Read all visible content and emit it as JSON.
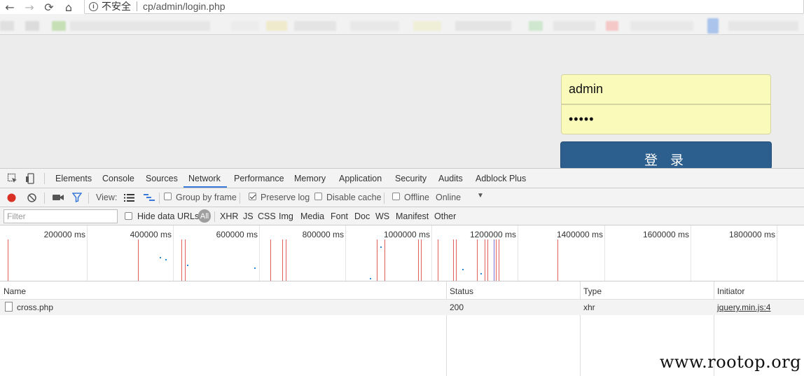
{
  "browser": {
    "insecure_label": "不安全",
    "url": "cp/admin/login.php"
  },
  "login": {
    "username_value": "admin",
    "password_value": "•••••",
    "submit_label": "登 录"
  },
  "devtools": {
    "tabs": [
      "Elements",
      "Console",
      "Sources",
      "Network",
      "Performance",
      "Memory",
      "Application",
      "Security",
      "Audits",
      "Adblock Plus"
    ],
    "active_tab": "Network",
    "toolbar": {
      "view_label": "View:",
      "group_by_frame": "Group by frame",
      "preserve_log": "Preserve log",
      "disable_cache": "Disable cache",
      "offline": "Offline",
      "throttle": "Online"
    },
    "filter": {
      "placeholder": "Filter",
      "hide_data_urls": "Hide data URLs",
      "types": [
        "All",
        "XHR",
        "JS",
        "CSS",
        "Img",
        "Media",
        "Font",
        "Doc",
        "WS",
        "Manifest",
        "Other"
      ]
    },
    "overview_ticks": [
      "200000 ms",
      "400000 ms",
      "600000 ms",
      "800000 ms",
      "1000000 ms",
      "1200000 ms",
      "1400000 ms",
      "1600000 ms",
      "1800000 ms"
    ],
    "columns": [
      "Name",
      "Status",
      "Type",
      "Initiator"
    ],
    "rows": [
      {
        "name": "cross.php",
        "status": "200",
        "type": "xhr",
        "initiator": "jquery.min.js:4"
      }
    ]
  },
  "watermark": "www.rootop.org",
  "colors": {
    "record": "#d93025",
    "accent": "#3879d9",
    "login_button": "#2d5f8e",
    "autofill": "#fafbbb"
  }
}
